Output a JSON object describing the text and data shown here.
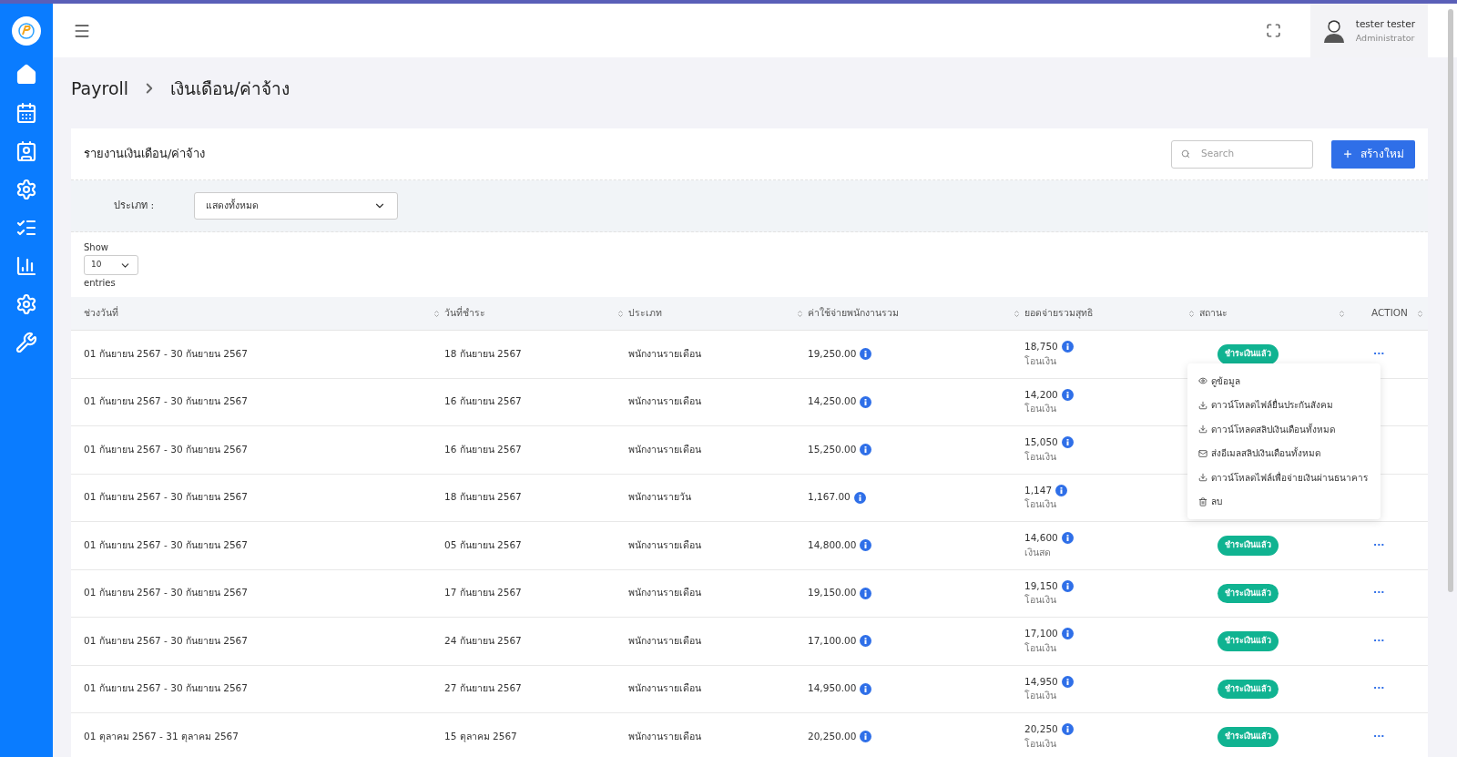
{
  "breadcrumb": {
    "root": "Payroll",
    "current": "เงินเดือน/ค่าจ้าง"
  },
  "user": {
    "name": "tester tester",
    "role": "Administrator"
  },
  "card": {
    "title": "รายงานเงินเดือน/ค่าจ้าง",
    "search": {
      "placeholder": "Search"
    },
    "create_button": "สร้างใหม่"
  },
  "filter": {
    "label": "ประเภท :",
    "value": "แสดงทั้งหมด"
  },
  "page_size": {
    "show": "Show",
    "value": "10",
    "entries": "entries"
  },
  "table": {
    "columns": [
      "ช่วงวันที่",
      "วันที่ชำระ",
      "ประเภท",
      "ค่าใช้จ่ายพนักงานรวม",
      "ยอดจ่ายรวมสุทธิ",
      "สถานะ",
      "ACTION"
    ],
    "rows": [
      {
        "period": "01 กันยายน 2567 - 30 กันยายน 2567",
        "paid_date": "18 กันยายน 2567",
        "type": "พนักงานรายเดือน",
        "cost": "19,250.00",
        "net": "18,750",
        "method": "โอนเงิน",
        "status": "ชำระเงินแล้ว",
        "action": "···"
      },
      {
        "period": "01 กันยายน 2567 - 30 กันยายน 2567",
        "paid_date": "16 กันยายน 2567",
        "type": "พนักงานรายเดือน",
        "cost": "14,250.00",
        "net": "14,200",
        "method": "โอนเงิน"
      },
      {
        "period": "01 กันยายน 2567 - 30 กันยายน 2567",
        "paid_date": "16 กันยายน 2567",
        "type": "พนักงานรายเดือน",
        "cost": "15,250.00",
        "net": "15,050",
        "method": "โอนเงิน"
      },
      {
        "period": "01 กันยายน 2567 - 30 กันยายน 2567",
        "paid_date": "18 กันยายน 2567",
        "type": "พนักงานรายวัน",
        "cost": "1,167.00",
        "net": "1,147",
        "method": "โอนเงิน"
      },
      {
        "period": "01 กันยายน 2567 - 30 กันยายน 2567",
        "paid_date": "05 กันยายน 2567",
        "type": "พนักงานรายเดือน",
        "cost": "14,800.00",
        "net": "14,600",
        "method": "เงินสด",
        "status": "ชำระเงินแล้ว",
        "action": "···"
      },
      {
        "period": "01 กันยายน 2567 - 30 กันยายน 2567",
        "paid_date": "17 กันยายน 2567",
        "type": "พนักงานรายเดือน",
        "cost": "19,150.00",
        "net": "19,150",
        "method": "โอนเงิน",
        "status": "ชำระเงินแล้ว",
        "action": "···"
      },
      {
        "period": "01 กันยายน 2567 - 30 กันยายน 2567",
        "paid_date": "24 กันยายน 2567",
        "type": "พนักงานรายเดือน",
        "cost": "17,100.00",
        "net": "17,100",
        "method": "โอนเงิน",
        "status": "ชำระเงินแล้ว",
        "action": "···"
      },
      {
        "period": "01 กันยายน 2567 - 30 กันยายน 2567",
        "paid_date": "27 กันยายน 2567",
        "type": "พนักงานรายเดือน",
        "cost": "14,950.00",
        "net": "14,950",
        "method": "โอนเงิน",
        "status": "ชำระเงินแล้ว",
        "action": "···"
      },
      {
        "period": "01 ตุลาคม 2567 - 31 ตุลาคม 2567",
        "paid_date": "15 ตุลาคม 2567",
        "type": "พนักงานรายเดือน",
        "cost": "20,250.00",
        "net": "20,250",
        "method": "โอนเงิน",
        "status": "ชำระเงินแล้ว",
        "action": "···"
      }
    ]
  },
  "action_menu": {
    "items": [
      {
        "kind": "view",
        "label": "ดูข้อมูล"
      },
      {
        "kind": "download",
        "label": "ดาวน์โหลดไฟล์ยื่นประกันสังคม"
      },
      {
        "kind": "download",
        "label": "ดาวน์โหลดสลิปเงินเดือนทั้งหมด"
      },
      {
        "kind": "email",
        "label": "ส่งอีเมลสลิปเงินเดือนทั้งหมด"
      },
      {
        "kind": "download",
        "label": "ดาวน์โหลดไฟล์เพื่อจ่ายเงินผ่านธนาคาร"
      },
      {
        "kind": "delete",
        "label": "ลบ"
      }
    ]
  }
}
